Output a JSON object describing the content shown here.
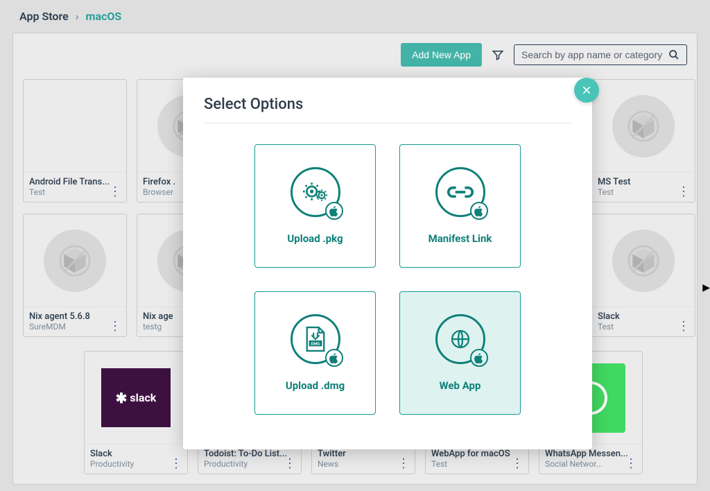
{
  "breadcrumb": {
    "root": "App Store",
    "current": "macOS"
  },
  "toolbar": {
    "add_label": "Add New App",
    "search_placeholder": "Search by app name or category"
  },
  "cards_row1": [
    {
      "title": "Android File Trans...",
      "category": "Test",
      "thumb": "blank"
    },
    {
      "title": "Firefox .",
      "category": "Browser",
      "thumb": "box"
    },
    {
      "title": "",
      "category": "",
      "thumb": "box"
    },
    {
      "title": "",
      "category": "",
      "thumb": "box"
    },
    {
      "title": "",
      "category": "",
      "thumb": "box"
    },
    {
      "title": "MS Test",
      "category": "Test",
      "thumb": "box"
    }
  ],
  "cards_row2": [
    {
      "title": "Nix agent 5.6.8",
      "category": "SureMDM",
      "thumb": "box"
    },
    {
      "title": "Nix age",
      "category": "testg",
      "thumb": "box"
    },
    {
      "title": "",
      "category": "",
      "thumb": "box"
    },
    {
      "title": "",
      "category": "",
      "thumb": "box"
    },
    {
      "title": "",
      "category": "",
      "thumb": "box"
    },
    {
      "title": "Slack",
      "category": "Test",
      "thumb": "box"
    }
  ],
  "cards_row3": [
    {
      "title": "Slack",
      "category": "Productivity",
      "thumb": "slack"
    },
    {
      "title": "Todoist: To-Do List...",
      "category": "Productivity",
      "thumb": "hidden"
    },
    {
      "title": "Twitter",
      "category": "News",
      "thumb": "hidden"
    },
    {
      "title": "WebApp for macOS",
      "category": "Test",
      "thumb": "hidden"
    },
    {
      "title": "WhatsApp Messen...",
      "category": "Social Networ...",
      "thumb": "whatsapp"
    }
  ],
  "modal": {
    "title": "Select Options",
    "options": [
      {
        "label": "Upload .pkg",
        "icon": "gears",
        "selected": false
      },
      {
        "label": "Manifest Link",
        "icon": "link",
        "selected": false
      },
      {
        "label": "Upload .dmg",
        "icon": "dmg",
        "selected": false
      },
      {
        "label": "Web App",
        "icon": "globe",
        "selected": true
      }
    ]
  }
}
